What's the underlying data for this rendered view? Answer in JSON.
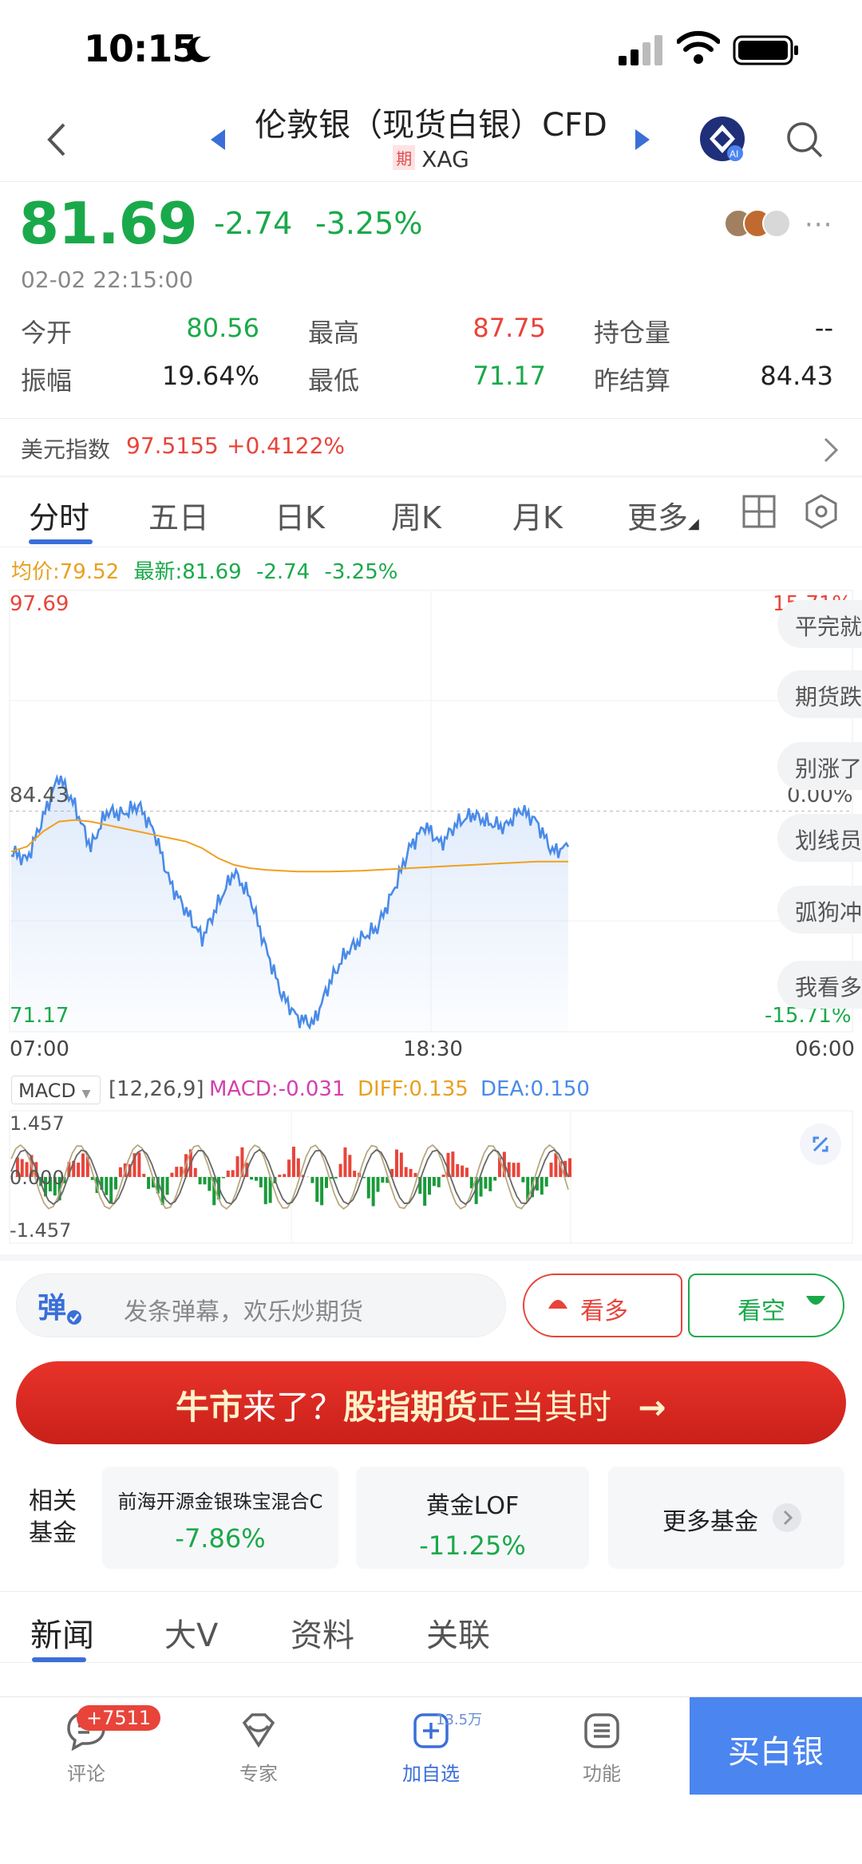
{
  "status": {
    "time": "10:15"
  },
  "header": {
    "title": "伦敦银（现货白银）CFD",
    "badge": "期",
    "code": "XAG"
  },
  "quote": {
    "price": "81.69",
    "change": "-2.74",
    "change_pct": "-3.25%",
    "datetime": "02-02 22:15:00",
    "more": "···"
  },
  "stats": {
    "open_label": "今开",
    "open": "80.56",
    "high_label": "最高",
    "high": "87.75",
    "oi_label": "持仓量",
    "oi": "--",
    "amp_label": "振幅",
    "amp": "19.64%",
    "low_label": "最低",
    "low": "71.17",
    "prev_label": "昨结算",
    "prev": "84.43"
  },
  "usd_index": {
    "label": "美元指数",
    "value": "97.5155",
    "change": "+0.4122%"
  },
  "tabs": [
    "分时",
    "五日",
    "日K",
    "周K",
    "月K",
    "更多"
  ],
  "legend": {
    "avg": "均价:79.52",
    "latest": "最新:81.69",
    "chg": "-2.74",
    "pct": "-3.25%"
  },
  "chart_labels": {
    "y_top": "97.69",
    "y_mid": "84.43",
    "y_bot": "71.17",
    "pct_top": "15.71%",
    "pct_mid": "0.00%",
    "pct_bot": "-15.71%",
    "x_start": "07:00",
    "x_mid": "18:30",
    "x_end": "06:00"
  },
  "danmaku_bubbles": [
    "平完就",
    "期货跌",
    "别涨了",
    "划线员",
    "弧狗冲",
    "我看多"
  ],
  "macd": {
    "selector": "MACD",
    "params": "[12,26,9]",
    "macd": "MACD:-0.031",
    "diff": "DIFF:0.135",
    "dea": "DEA:0.150",
    "y_top": "1.457",
    "y_mid": "0.000",
    "y_bot": "-1.457"
  },
  "danmaku": {
    "placeholder": "发条弹幕，欢乐炒期货",
    "icon_text": "弹",
    "bull": "看多",
    "bear": "看空"
  },
  "banner": {
    "part1": "牛市",
    "part2": "来了？",
    "part3": "股指期货",
    "part4": "正当其时"
  },
  "funds": {
    "label": "相关基金",
    "items": [
      {
        "name": "前海开源金银珠宝混合C",
        "value": "-7.86%"
      },
      {
        "name": "黄金LOF",
        "value": "-11.25%"
      }
    ],
    "more": "更多基金"
  },
  "news_tabs": [
    "新闻",
    "大V",
    "资料",
    "关联"
  ],
  "bottom": {
    "comment": "评论",
    "comment_badge": "+7511",
    "expert": "专家",
    "add": "加自选",
    "add_badge": "13.5万",
    "func": "功能",
    "buy": "买白银"
  },
  "chart_data": {
    "type": "line",
    "title": "",
    "xlabel": "",
    "ylabel": "",
    "x_ticks": [
      "07:00",
      "18:30",
      "06:00"
    ],
    "ylim": [
      71.17,
      97.69
    ],
    "reference": 84.43,
    "series": [
      {
        "name": "最新",
        "color": "#4a8be8",
        "values": [
          82.0,
          81.0,
          83.5,
          86.5,
          85.2,
          82.8,
          84.5,
          83.8,
          84.2,
          83.0,
          80.5,
          79.0,
          77.0,
          78.5,
          80.2,
          79.0,
          76.5,
          74.0,
          72.3,
          71.4,
          73.5,
          75.5,
          77.0,
          78.0,
          80.0,
          82.0,
          83.0,
          82.0,
          83.8,
          84.8,
          84.2,
          83.4,
          84.0,
          83.3,
          82.0,
          82.8
        ]
      },
      {
        "name": "均价",
        "color": "#f0a020",
        "values": [
          82.0,
          82.3,
          83.2,
          83.8,
          83.9,
          83.8,
          83.6,
          83.4,
          83.2,
          83.0,
          82.8,
          82.6,
          82.2,
          81.6,
          81.2,
          81.0,
          80.9,
          80.85,
          80.8,
          80.8,
          80.8,
          80.82,
          80.85,
          80.9,
          80.95,
          81.0,
          81.05,
          81.1,
          81.15,
          81.2,
          81.25,
          81.3,
          81.35,
          81.4,
          81.4,
          81.4
        ]
      }
    ]
  }
}
